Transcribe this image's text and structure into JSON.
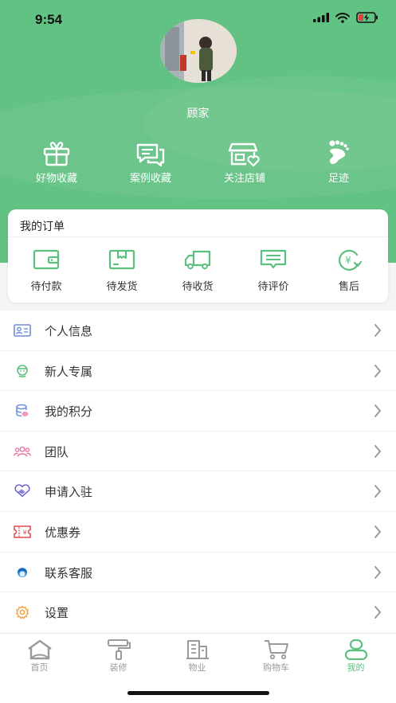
{
  "status_bar": {
    "time": "9:54"
  },
  "profile": {
    "username": "顾家"
  },
  "quick_actions": [
    {
      "label": "好物收藏",
      "icon": "gift-icon"
    },
    {
      "label": "案例收藏",
      "icon": "message-icon"
    },
    {
      "label": "关注店铺",
      "icon": "store-icon"
    },
    {
      "label": "足迹",
      "icon": "footprint-icon"
    }
  ],
  "orders": {
    "title": "我的订单",
    "items": [
      {
        "label": "待付款",
        "icon": "wallet-icon"
      },
      {
        "label": "待发货",
        "icon": "box-icon"
      },
      {
        "label": "待收货",
        "icon": "truck-icon"
      },
      {
        "label": "待评价",
        "icon": "review-icon"
      },
      {
        "label": "售后",
        "icon": "refund-icon"
      }
    ]
  },
  "menu": [
    {
      "label": "个人信息",
      "icon": "id-card-icon",
      "color": "#6c8fd6"
    },
    {
      "label": "新人专属",
      "icon": "newcomer-icon",
      "color": "#5cbf7e"
    },
    {
      "label": "我的积分",
      "icon": "coins-icon",
      "color": "#6c8fd6"
    },
    {
      "label": "团队",
      "icon": "team-icon",
      "color": "#e86ca0"
    },
    {
      "label": "申请入驻",
      "icon": "handshake-icon",
      "color": "#6a5fd0"
    },
    {
      "label": "优惠券",
      "icon": "coupon-icon",
      "color": "#e04848"
    },
    {
      "label": "联系客服",
      "icon": "customer-service-icon",
      "color": "#2b8fe0"
    },
    {
      "label": "设置",
      "icon": "gear-icon",
      "color": "#f0a040"
    }
  ],
  "tabbar": [
    {
      "label": "首页",
      "icon": "home-icon"
    },
    {
      "label": "装修",
      "icon": "paint-roller-icon"
    },
    {
      "label": "物业",
      "icon": "building-icon"
    },
    {
      "label": "购物车",
      "icon": "cart-icon"
    },
    {
      "label": "我的",
      "icon": "profile-icon",
      "active": true
    }
  ],
  "colors": {
    "brand": "#62c283",
    "tab_active": "#5cbf7e",
    "tab_inactive": "#9a9a9a"
  }
}
